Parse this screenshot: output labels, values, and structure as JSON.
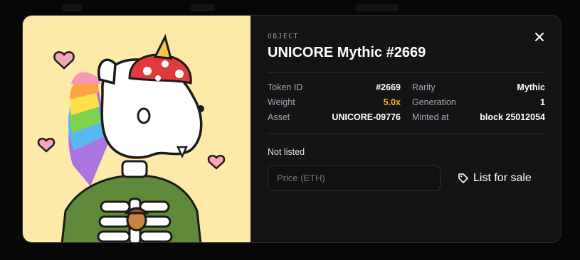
{
  "modal": {
    "eyebrow": "OBJECT",
    "title": "UNICORE Mythic #2669",
    "close_icon": "close-icon",
    "image_icon": "unicorn-skeleton-art"
  },
  "details": {
    "token_id_label": "Token ID",
    "token_id_value": "#2669",
    "rarity_label": "Rarity",
    "rarity_value": "Mythic",
    "weight_label": "Weight",
    "weight_value": "5.0x",
    "generation_label": "Generation",
    "generation_value": "1",
    "asset_label": "Asset",
    "asset_value": "UNICORE-09776",
    "minted_label": "Minted at",
    "minted_value": "block 25012054"
  },
  "listing": {
    "status": "Not listed",
    "price_placeholder": "Price (ETH)",
    "sale_button_label": "List for sale",
    "sale_icon": "tag-icon"
  },
  "colors": {
    "accent": "#f5b41f",
    "art_background": "#fde9a8",
    "panel_background": "#141416"
  }
}
